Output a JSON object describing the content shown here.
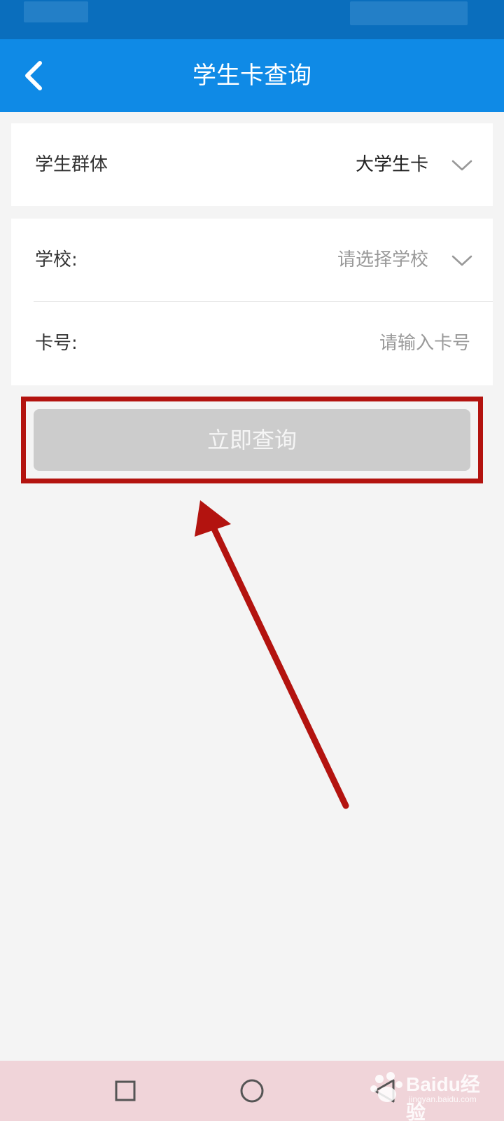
{
  "header": {
    "title": "学生卡查询"
  },
  "group_card": {
    "label": "学生群体",
    "value": "大学生卡"
  },
  "form": {
    "school_label": "学校:",
    "school_placeholder": "请选择学校",
    "card_label": "卡号:",
    "card_placeholder": "请输入卡号"
  },
  "actions": {
    "query_label": "立即查询"
  },
  "watermark": {
    "brand": "Baidu经验",
    "url": "jingyan.baidu.com"
  },
  "colors": {
    "app_bar": "#0f8ae6",
    "status_bar": "#0a6ebd",
    "button_disabled": "#cccccc",
    "annotation_red": "#b3130f",
    "nav_bar": "#f0d4d9"
  },
  "icons": {
    "back": "back-chevron-icon",
    "dropdown": "chevron-down-icon",
    "nav_recent": "square-icon",
    "nav_home": "circle-icon",
    "nav_back": "triangle-back-icon"
  }
}
